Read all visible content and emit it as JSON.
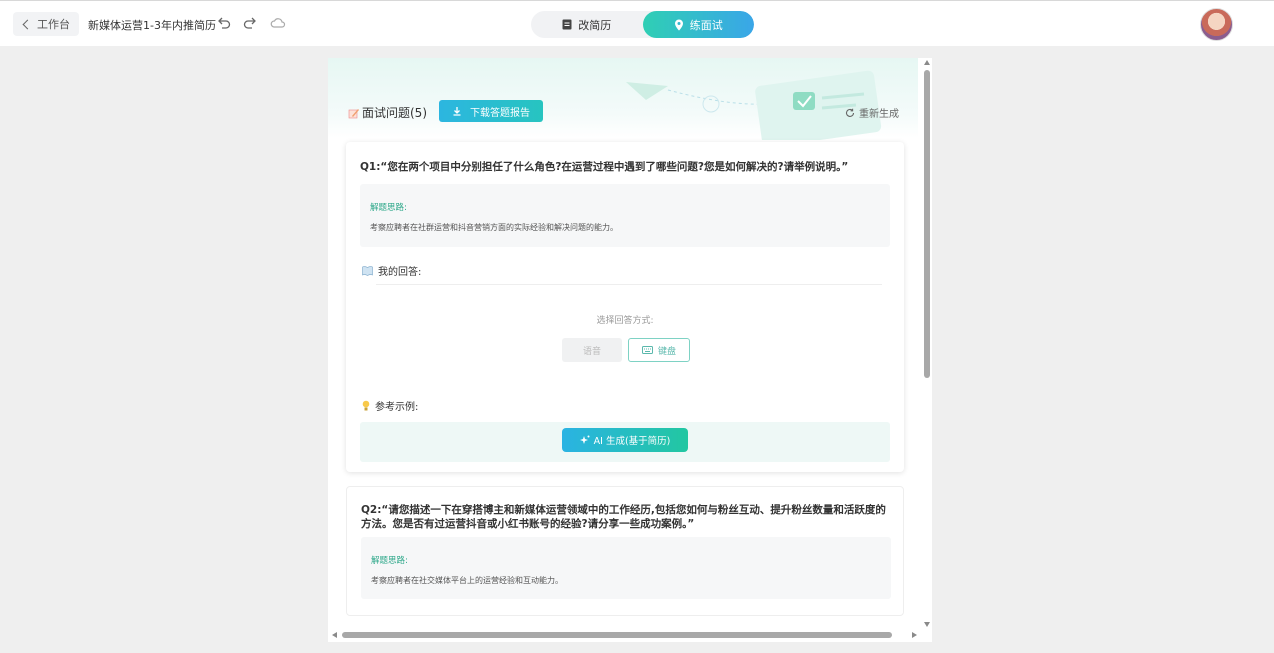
{
  "topbar": {
    "back_label": "工作台",
    "doc_title": "新媒体运营1-3年内推简历",
    "tabs": [
      {
        "label": "改简历",
        "icon": "document-icon",
        "active": false
      },
      {
        "label": "练面试",
        "icon": "location-pin-icon",
        "active": true
      }
    ]
  },
  "panel": {
    "title": "面试问题(5)",
    "download_label": "下载答题报告",
    "regenerate_label": "重新生成"
  },
  "questions": [
    {
      "text": "Q1:“您在两个项目中分别担任了什么角色?在运营过程中遇到了哪些问题?您是如何解决的?请举例说明。”",
      "hint_label": "解题思路:",
      "hint_text": "考察应聘者在社群运营和抖音营销方面的实际经验和解决问题的能力。",
      "my_answer_label": "我的回答:",
      "choose_label": "选择回答方式:",
      "voice_label": "语音",
      "keyboard_label": "键盘",
      "reference_label": "参考示例:",
      "ai_button_label": "AI 生成(基于简历)"
    },
    {
      "text": "Q2:“请您描述一下在穿搭博主和新媒体运营领域中的工作经历,包括您如何与粉丝互动、提升粉丝数量和活跃度的方法。您是否有过运营抖音或小红书账号的经验?请分享一些成功案例。”",
      "hint_label": "解题思路:",
      "hint_text": "考察应聘者在社交媒体平台上的运营经验和互动能力。"
    }
  ],
  "colors": {
    "accent_teal": "#2fcfb4",
    "accent_blue": "#3aa6e8",
    "hint_green": "#2ea88a"
  }
}
